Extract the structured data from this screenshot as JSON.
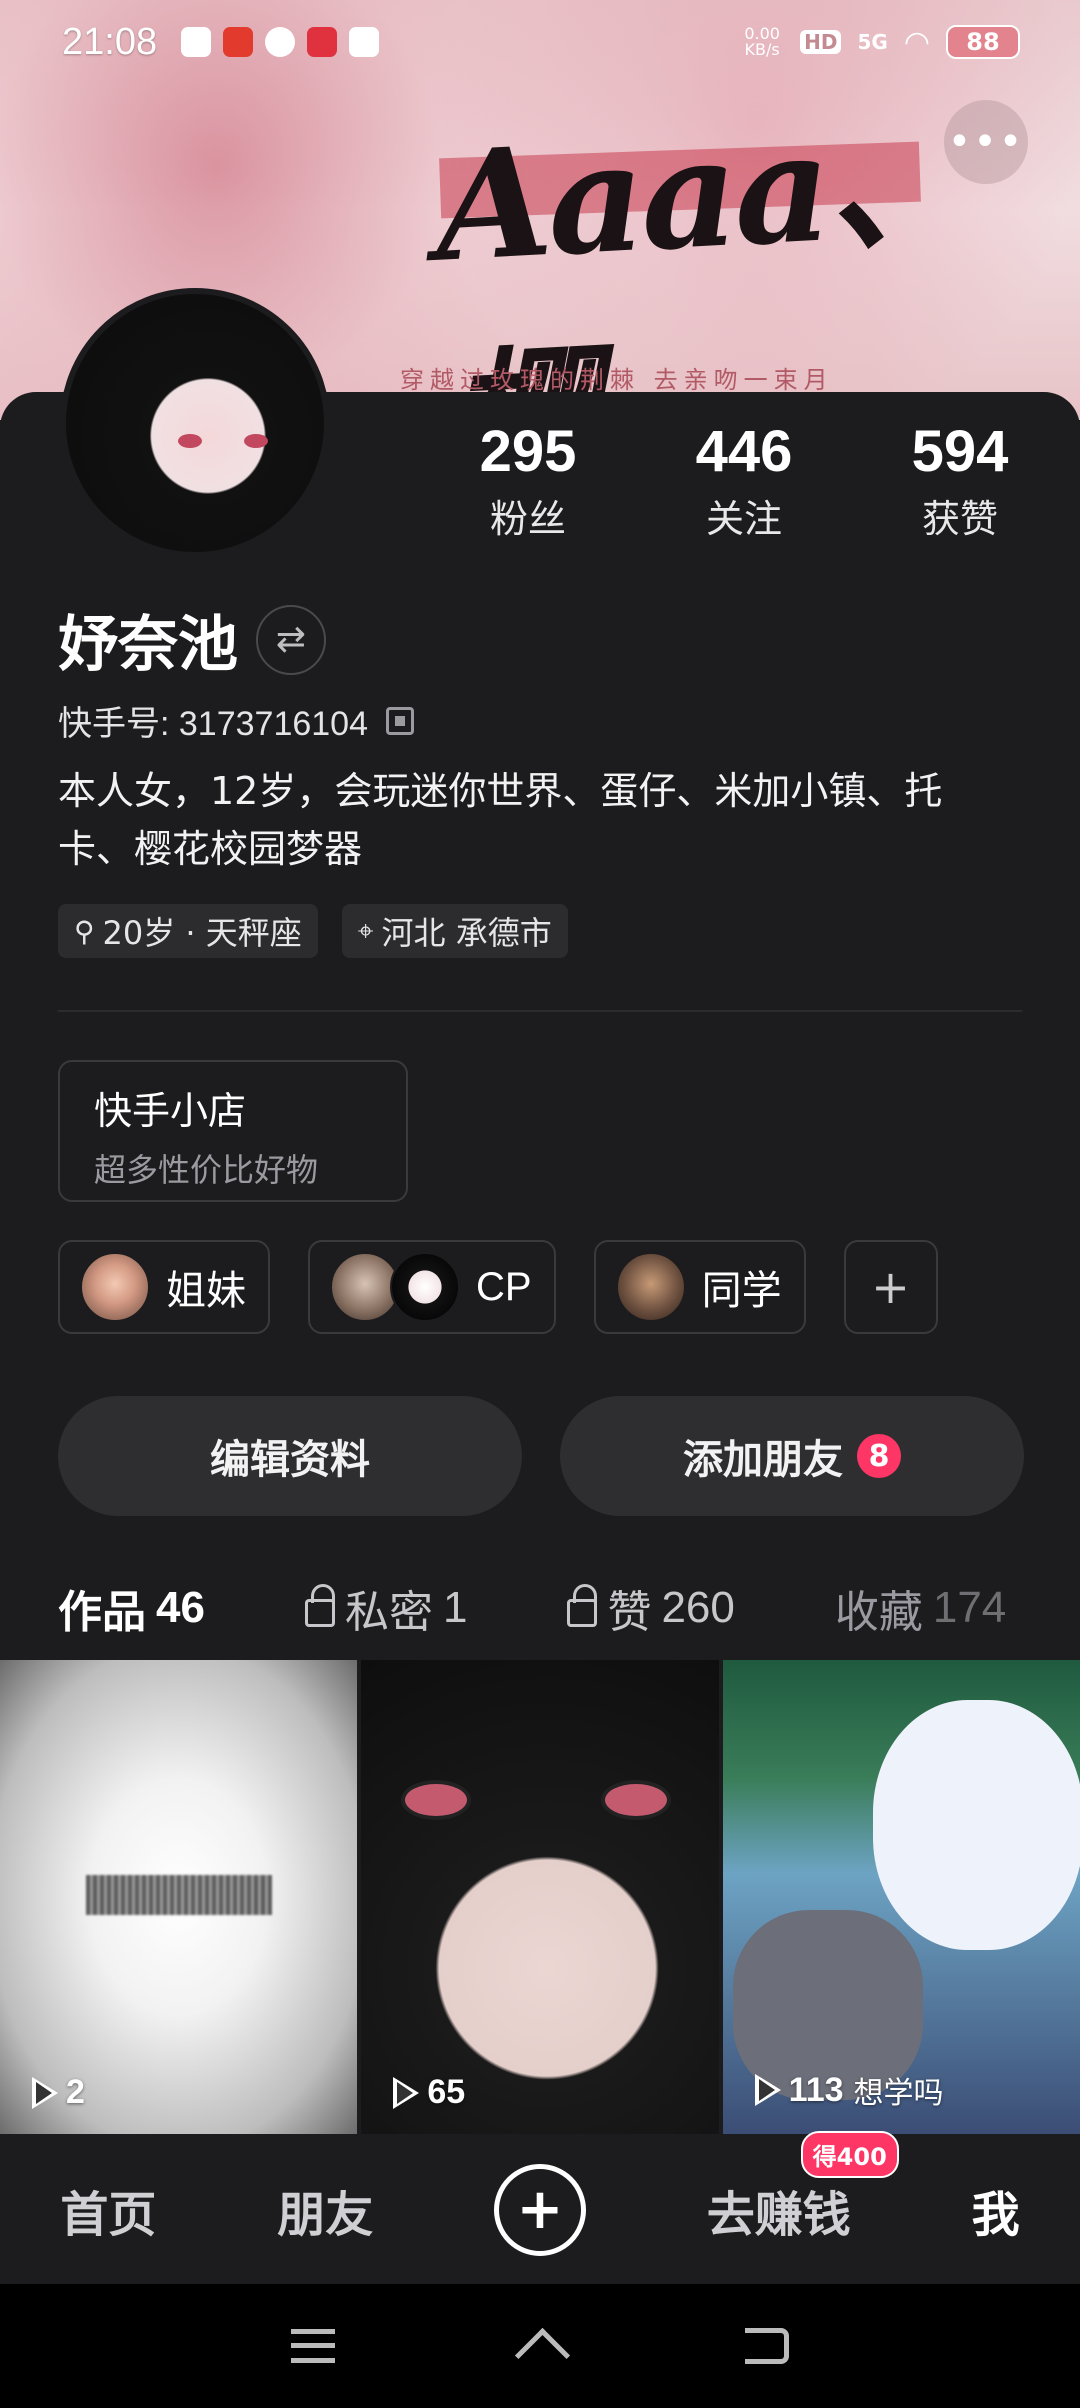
{
  "status_bar": {
    "time": "21:08",
    "net_speed": "0.00 KB/s",
    "net_type": "5G",
    "hd_label": "HD",
    "battery": "88"
  },
  "banner": {
    "art_text": "Aaaa、樱",
    "caption": "穿越过玫瑰的荆棘 去亲吻一束月"
  },
  "profile": {
    "name": "妤奈池",
    "uid_label": "快手号: 3173716104",
    "bio": "本人女，12岁，会玩迷你世界、蛋仔、米加小镇、托卡、樱花校园梦器",
    "tags": [
      {
        "icon": "gender-age-icon",
        "text": "20岁 · 天秤座"
      },
      {
        "icon": "location-icon",
        "text": "河北 承德市"
      }
    ]
  },
  "stats": [
    {
      "value": "295",
      "label": "粉丝"
    },
    {
      "value": "446",
      "label": "关注"
    },
    {
      "value": "594",
      "label": "获赞"
    }
  ],
  "shop": {
    "title": "快手小店",
    "subtitle": "超多性价比好物"
  },
  "groups": [
    {
      "label": "姐妹"
    },
    {
      "label": "CP"
    },
    {
      "label": "同学"
    }
  ],
  "add_group_symbol": "+",
  "actions": {
    "edit_label": "编辑资料",
    "add_friend_label": "添加朋友",
    "add_friend_badge": "8"
  },
  "tabs": [
    {
      "label": "作品",
      "count": "46"
    },
    {
      "label": "私密",
      "count": "1"
    },
    {
      "label": "赞",
      "count": "260"
    },
    {
      "label": "收藏",
      "count": "174"
    }
  ],
  "videos": [
    {
      "plays": "2",
      "note": ""
    },
    {
      "plays": "65",
      "note": ""
    },
    {
      "plays": "113",
      "note": "想学吗"
    }
  ],
  "bottom_nav": {
    "home": "首页",
    "friends": "朋友",
    "earn": "去赚钱",
    "earn_badge": "得400",
    "me": "我"
  },
  "colors": {
    "accent": "#fe3666",
    "background": "#1c1c1e"
  }
}
